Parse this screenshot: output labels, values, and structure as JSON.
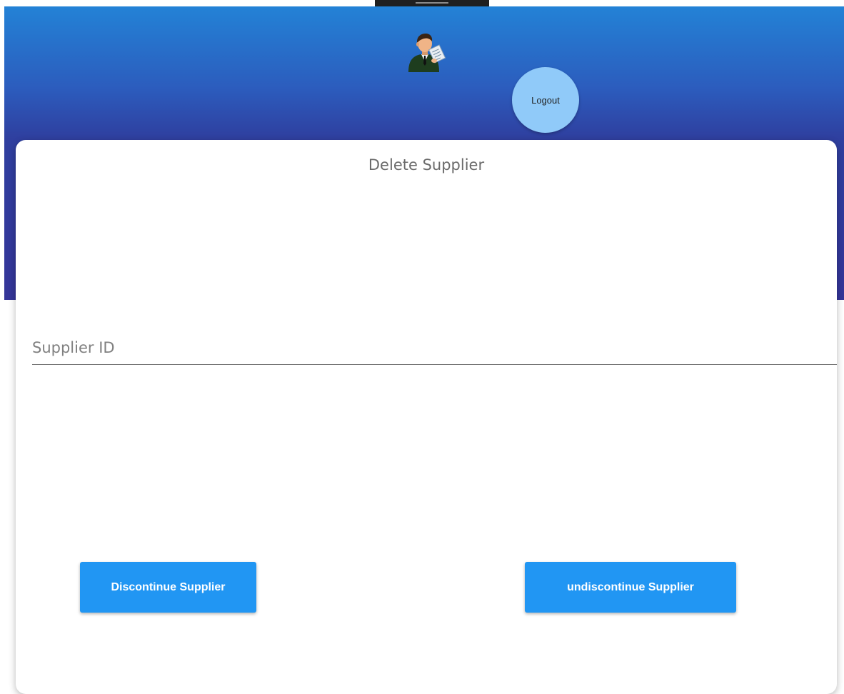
{
  "header": {
    "avatar_icon": "businessman-avatar-icon",
    "logout_label": "Logout",
    "gradient_colors": [
      "#2382d6",
      "#343598"
    ]
  },
  "card": {
    "title": "Delete Supplier",
    "supplier_id": {
      "value": "",
      "placeholder": "Supplier ID"
    },
    "buttons": {
      "discontinue_label": "Discontinue Supplier",
      "undiscontinue_label": "undiscontinue Supplier",
      "color": "#2196f3"
    }
  }
}
